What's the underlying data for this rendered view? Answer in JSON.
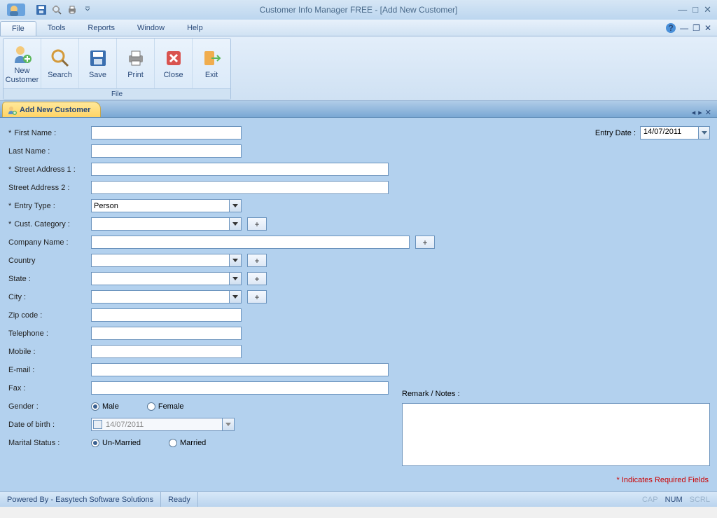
{
  "window": {
    "title": "Customer Info Manager FREE - [Add New Customer]"
  },
  "menus": {
    "file": "File",
    "tools": "Tools",
    "reports": "Reports",
    "window": "Window",
    "help": "Help"
  },
  "ribbon": {
    "group_label": "File",
    "new_customer": "New Customer",
    "search": "Search",
    "save": "Save",
    "print": "Print",
    "close": "Close",
    "exit": "Exit"
  },
  "tab": {
    "label": "Add New Customer"
  },
  "form": {
    "labels": {
      "first_name": "First Name :",
      "last_name": "Last Name :",
      "street1": "Street Address 1 :",
      "street2": "Street Address 2 :",
      "entry_type": "Entry Type :",
      "cust_category": "Cust. Category :",
      "company_name": "Company Name :",
      "country": "Country",
      "state": "State :",
      "city": "City :",
      "zip": "Zip code :",
      "telephone": "Telephone :",
      "mobile": "Mobile :",
      "email": "E-mail :",
      "fax": "Fax :",
      "gender": "Gender :",
      "dob": "Date of birth :",
      "marital": "Marital Status :",
      "entry_date": "Entry Date :",
      "remark": "Remark / Notes :"
    },
    "values": {
      "first_name": "",
      "last_name": "",
      "street1": "",
      "street2": "",
      "entry_type": "Person",
      "cust_category": "",
      "company_name": "",
      "country": "",
      "state": "",
      "city": "",
      "zip": "",
      "telephone": "",
      "mobile": "",
      "email": "",
      "fax": "",
      "dob": "14/07/2011",
      "entry_date": "14/07/2011",
      "remark": ""
    },
    "options": {
      "gender_male": "Male",
      "gender_female": "Female",
      "marital_unmarried": "Un-Married",
      "marital_married": "Married"
    },
    "required_note": "* Indicates Required Fields",
    "plus": "+",
    "asterisk": "* "
  },
  "status": {
    "powered": "Powered By - Easytech Software Solutions",
    "ready": "Ready",
    "cap": "CAP",
    "num": "NUM",
    "scrl": "SCRL"
  }
}
